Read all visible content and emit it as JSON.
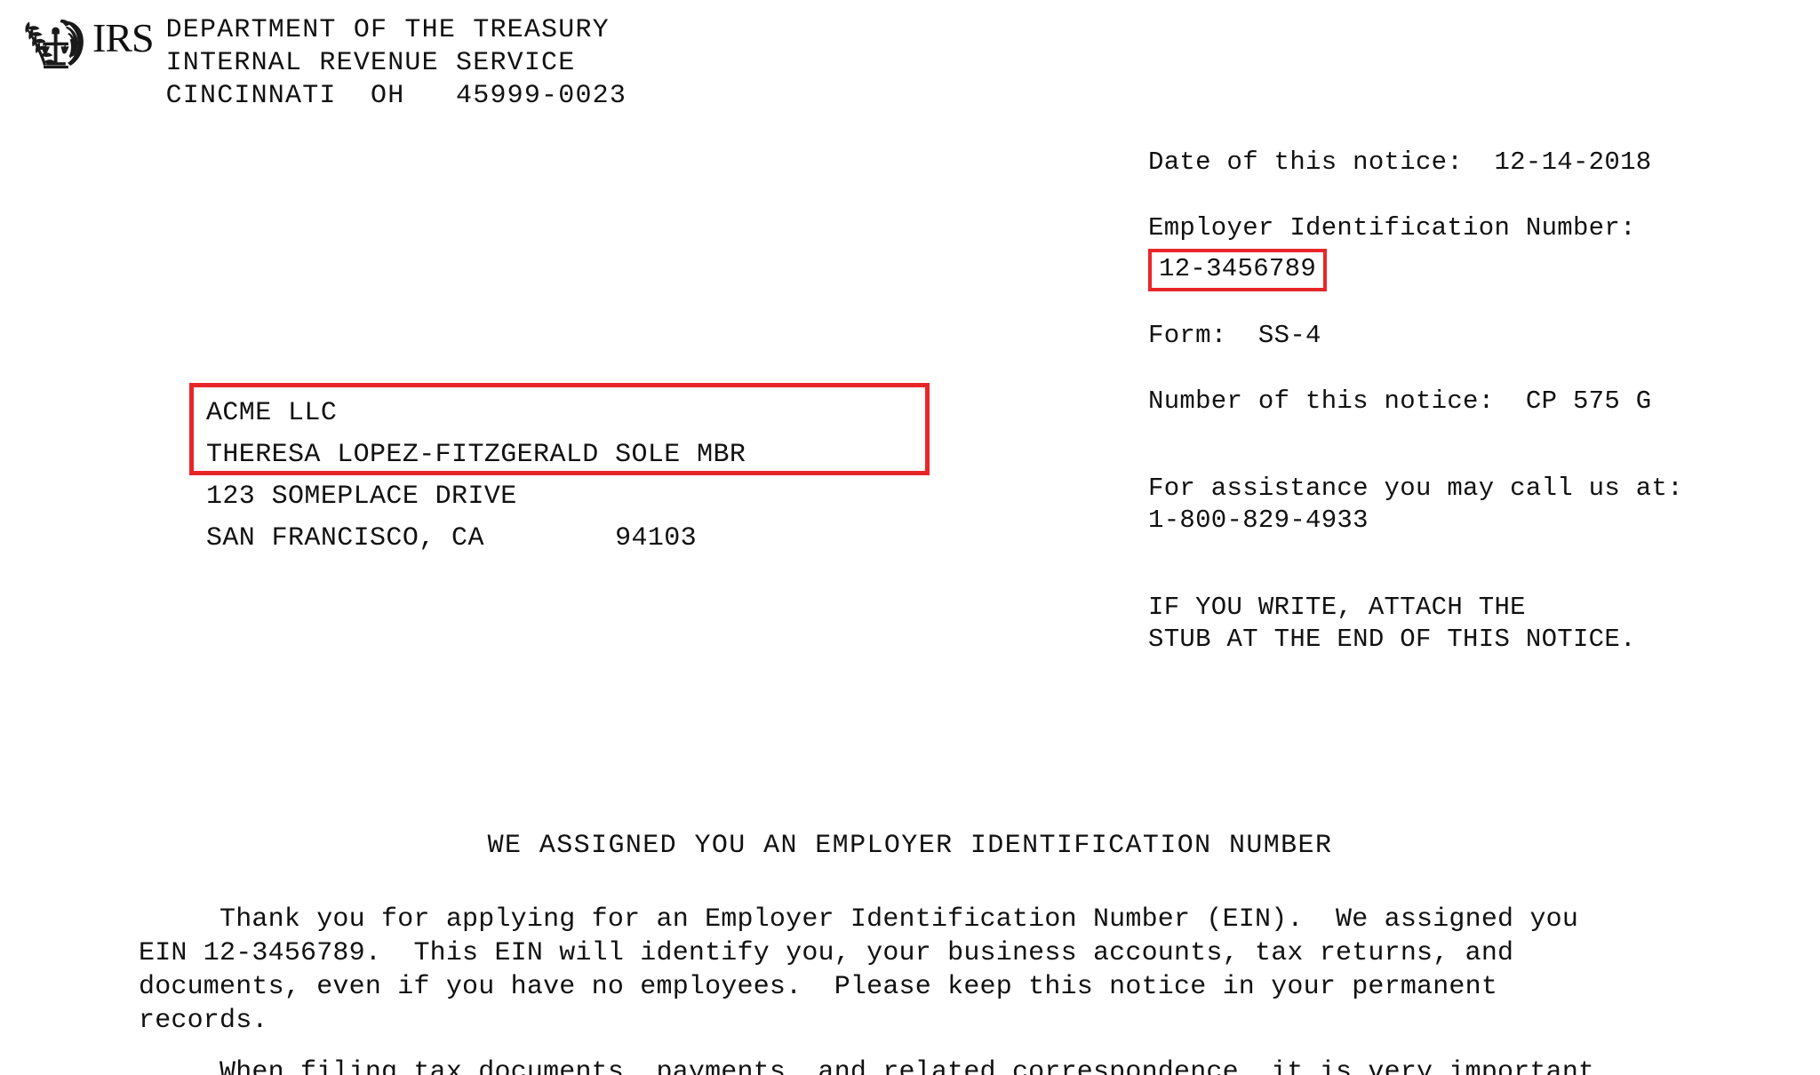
{
  "document": {
    "type": "irs-notice",
    "accent_color": "#e8262a",
    "text_color": "#111111",
    "background_color": "#ffffff"
  },
  "header": {
    "logo_icon": "irs-eagle-scales-seal-icon",
    "wordmark": "IRS",
    "agency_lines": [
      "DEPARTMENT OF THE TREASURY",
      "INTERNAL REVENUE SERVICE",
      "CINCINNATI  OH   45999-0023"
    ]
  },
  "meta": {
    "date_label": "Date of this notice:",
    "date_value": "12-14-2018",
    "date_line": "Date of this notice:  12-14-2018",
    "ein_label": "Employer Identification Number:",
    "ein_value": "12-3456789",
    "form_label": "Form:",
    "form_value": "SS-4",
    "form_line": "Form:  SS-4",
    "notice_number_label": "Number of this notice:",
    "notice_number_value": "CP 575 G",
    "notice_number_line": "Number of this notice:  CP 575 G",
    "assistance_line_1": "For assistance you may call us at:",
    "assistance_phone": "1-800-829-4933",
    "write_instruction_line_1": "IF YOU WRITE, ATTACH THE",
    "write_instruction_line_2": "STUB AT THE END OF THIS NOTICE."
  },
  "addressee": {
    "entity_name": "ACME LLC",
    "responsible_party": "THERESA LOPEZ-FITZGERALD SOLE MBR",
    "street": "123 SOMEPLACE DRIVE",
    "city_state_zip": "SAN FRANCISCO, CA        94103"
  },
  "body": {
    "title": "WE ASSIGNED YOU AN EMPLOYER IDENTIFICATION NUMBER",
    "paragraph_1_lines": [
      "     Thank you for applying for an Employer Identification Number (EIN).  We assigned you",
      "EIN 12-3456789.  This EIN will identify you, your business accounts, tax returns, and",
      "documents, even if you have no employees.  Please keep this notice in your permanent",
      "records."
    ],
    "paragraph_2_clipped_line": "     When filing tax documents, payments, and related correspondence, it is very important"
  }
}
